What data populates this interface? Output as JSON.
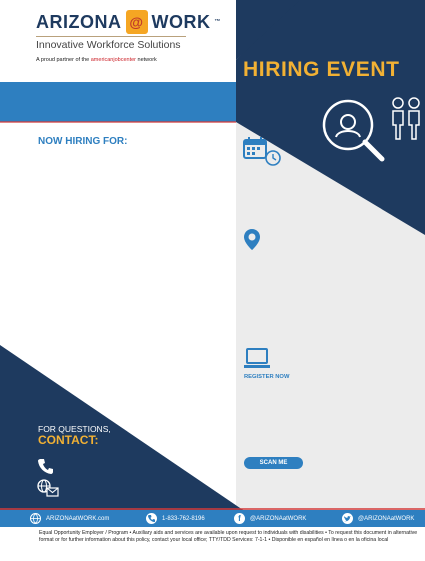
{
  "logo": {
    "brand_left": "ARIZONA",
    "brand_at": "@",
    "brand_right": "WORK",
    "tm": "™",
    "subtitle": "Innovative Workforce Solutions",
    "partner_prefix": "A proud partner of the",
    "partner_name": "americanjobcenter",
    "partner_suffix": "network"
  },
  "event": {
    "title": "HIRING EVENT"
  },
  "left": {
    "now_hiring": "NOW HIRING FOR:",
    "questions": "FOR QUESTIONS,",
    "contact": "CONTACT:"
  },
  "right": {
    "register": "REGISTER NOW",
    "scan": "SCAN ME"
  },
  "footer": {
    "website": "ARIZONAatWORK.com",
    "phone": "1-833-762-8196",
    "facebook": "@ARIZONAatWORK",
    "twitter": "@ARIZONAatWORK",
    "disclaimer": "Equal Opportunity Employer / Program • Auxiliary aids and services are available upon request to individuals with disabilities • To request this document in alternative format or for further information about this policy, contact your local office; TTY/TDD Services: 7-1-1 • Disponible en español en línea o en la oficina local"
  },
  "colors": {
    "navy": "#1e3a5f",
    "blue": "#2e7fc0",
    "gold": "#f2b134",
    "red": "#d33a3a",
    "panel_gray": "#ececec"
  },
  "icons": [
    "calendar-icon",
    "location-pin-icon",
    "laptop-icon",
    "phone-icon",
    "globe-mail-icon",
    "search-person-icon",
    "people-icon",
    "website-icon",
    "facebook-icon",
    "twitter-icon"
  ]
}
